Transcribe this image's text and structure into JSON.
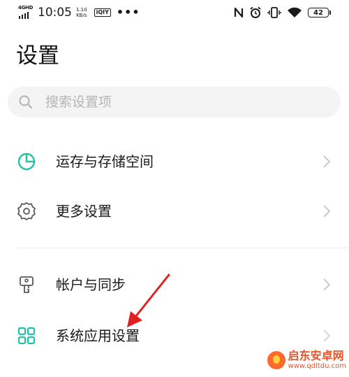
{
  "status_bar": {
    "network_type": "4GHD",
    "time": "10:05",
    "speed_value": "1.10",
    "speed_unit": "KB/s",
    "app_badge": "iQIY",
    "overflow": "•••",
    "battery_level": "42",
    "icons": [
      "signal-bars-icon",
      "nfc-icon",
      "alarm-icon",
      "vibrate-icon",
      "wifi-icon",
      "battery-icon"
    ]
  },
  "page": {
    "title": "设置"
  },
  "search": {
    "placeholder": "搜索设置项"
  },
  "items": [
    {
      "label": "运存与存储空间",
      "icon": "storage-pie-icon",
      "icon_color": "#1fc3a6"
    },
    {
      "label": "更多设置",
      "icon": "gear-icon",
      "icon_color": "#5a5a5a"
    },
    {
      "label": "帐户与同步",
      "icon": "account-sync-icon",
      "icon_color": "#5a5a5a"
    },
    {
      "label": "系统应用设置",
      "icon": "apps-grid-icon",
      "icon_color": "#1fc3a6"
    }
  ],
  "annotation": {
    "color": "#e02020"
  },
  "watermark": {
    "title": "启东安卓网",
    "url": "www.qdltdu.com"
  }
}
